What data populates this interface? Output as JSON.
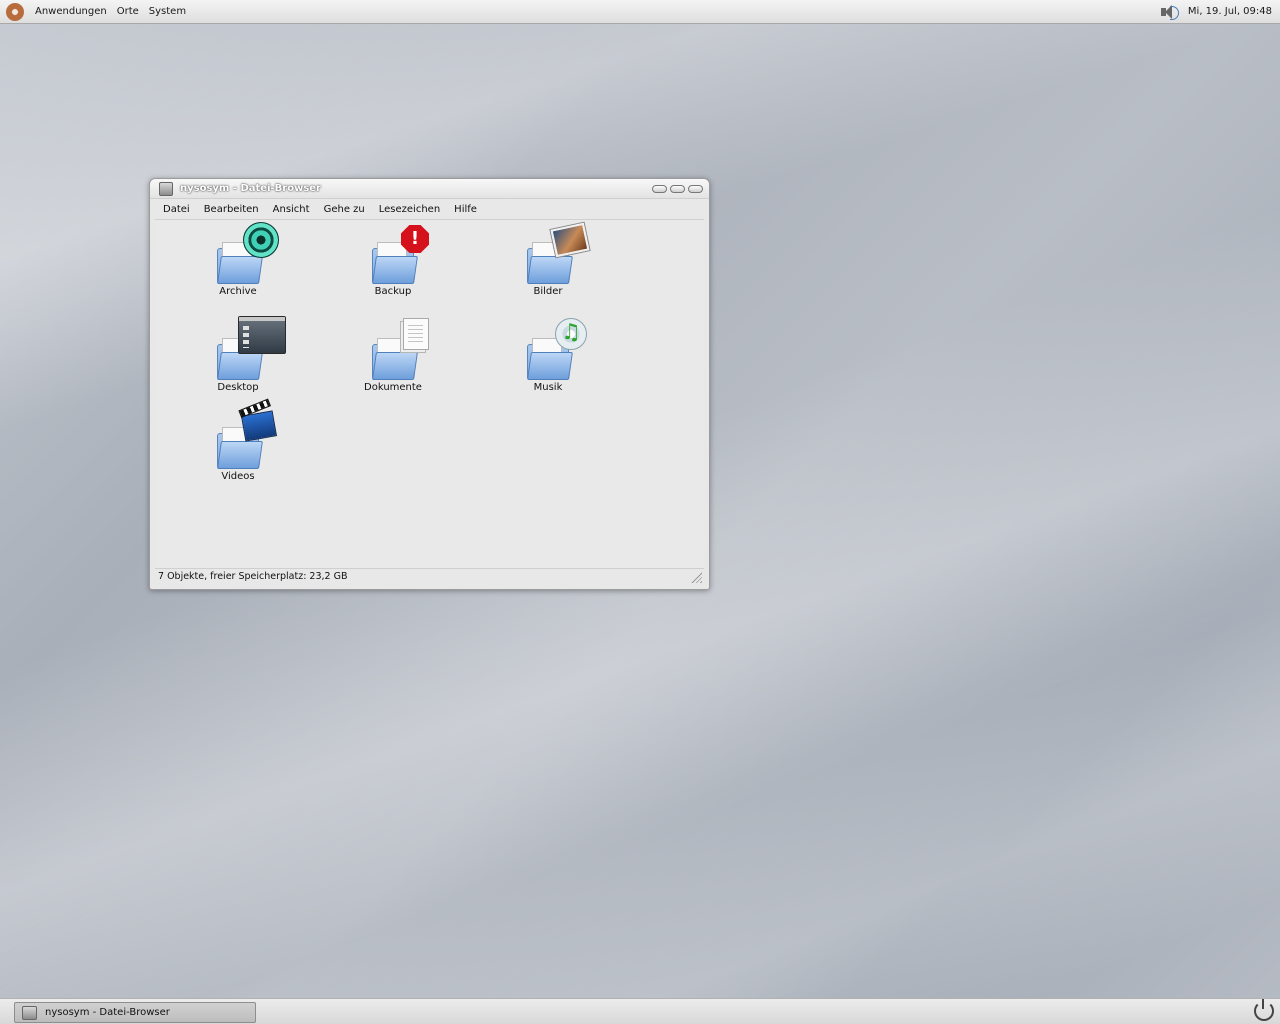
{
  "top_panel": {
    "menus": [
      "Anwendungen",
      "Orte",
      "System"
    ],
    "clock": "Mi, 19. Jul, 09:48",
    "icons": {
      "logo": "ubuntu-logo-icon",
      "volume": "volume-icon"
    }
  },
  "window": {
    "title": "nysosym - Datei-Browser",
    "menubar": [
      "Datei",
      "Bearbeiten",
      "Ansicht",
      "Gehe zu",
      "Lesezeichen",
      "Hilfe"
    ],
    "items": [
      {
        "label": "Archive",
        "icon": "folder-archive-icon"
      },
      {
        "label": "Backup",
        "icon": "folder-backup-icon"
      },
      {
        "label": "Bilder",
        "icon": "folder-pictures-icon"
      },
      {
        "label": "Desktop",
        "icon": "folder-desktop-icon"
      },
      {
        "label": "Dokumente",
        "icon": "folder-documents-icon"
      },
      {
        "label": "Musik",
        "icon": "folder-music-icon"
      },
      {
        "label": "Videos",
        "icon": "folder-videos-icon"
      }
    ],
    "status": "7 Objekte, freier Speicherplatz: 23,2 GB"
  },
  "taskbar": {
    "task_label": "nysosym - Datei-Browser",
    "backup_emblem_text": "!",
    "music_emblem_text": "♫"
  },
  "colors": {
    "folder_blue": "#7eaadf",
    "backup_red": "#d5121b"
  }
}
